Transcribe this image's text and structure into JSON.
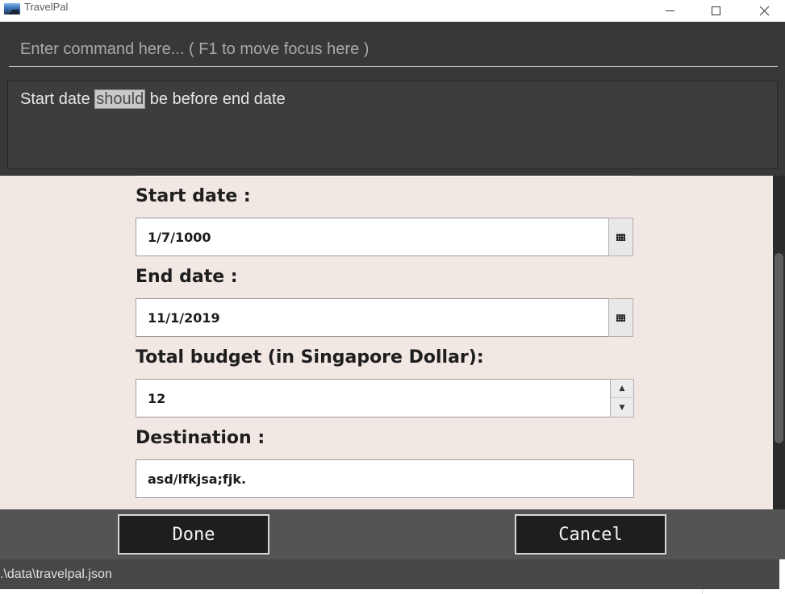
{
  "window": {
    "title": "TravelPal",
    "icon": "app-landscape-icon",
    "controls": {
      "minimize": "minimize",
      "maximize": "maximize",
      "close": "close"
    }
  },
  "command": {
    "placeholder": "Enter command here... ( F1 to move focus here )",
    "value": ""
  },
  "result": {
    "before": "Start date ",
    "highlighted": "should",
    "after": " be before end date"
  },
  "form": {
    "start_date": {
      "label": "Start date :",
      "value": "1/7/1000",
      "picker_icon": "calendar-icon"
    },
    "end_date": {
      "label": "End date :",
      "value": "11/1/2019",
      "picker_icon": "calendar-icon"
    },
    "budget": {
      "label": "Total budget (in Singapore Dollar):",
      "value": "12",
      "up_icon": "triangle-up-icon",
      "down_icon": "triangle-down-icon"
    },
    "destination": {
      "label": "Destination :",
      "value": "asd/lfkjsa;fjk."
    }
  },
  "actions": {
    "done_label": "Done",
    "cancel_label": "Cancel"
  },
  "status": {
    "file_path": ".\\data\\travelpal.json"
  },
  "colors": {
    "dark_panel": "#383838",
    "form_background": "#f1e7e3",
    "button_bar": "#545454",
    "button_face": "#1e1e1e",
    "status_bar": "#474747",
    "highlight": "#c9c9c9"
  }
}
